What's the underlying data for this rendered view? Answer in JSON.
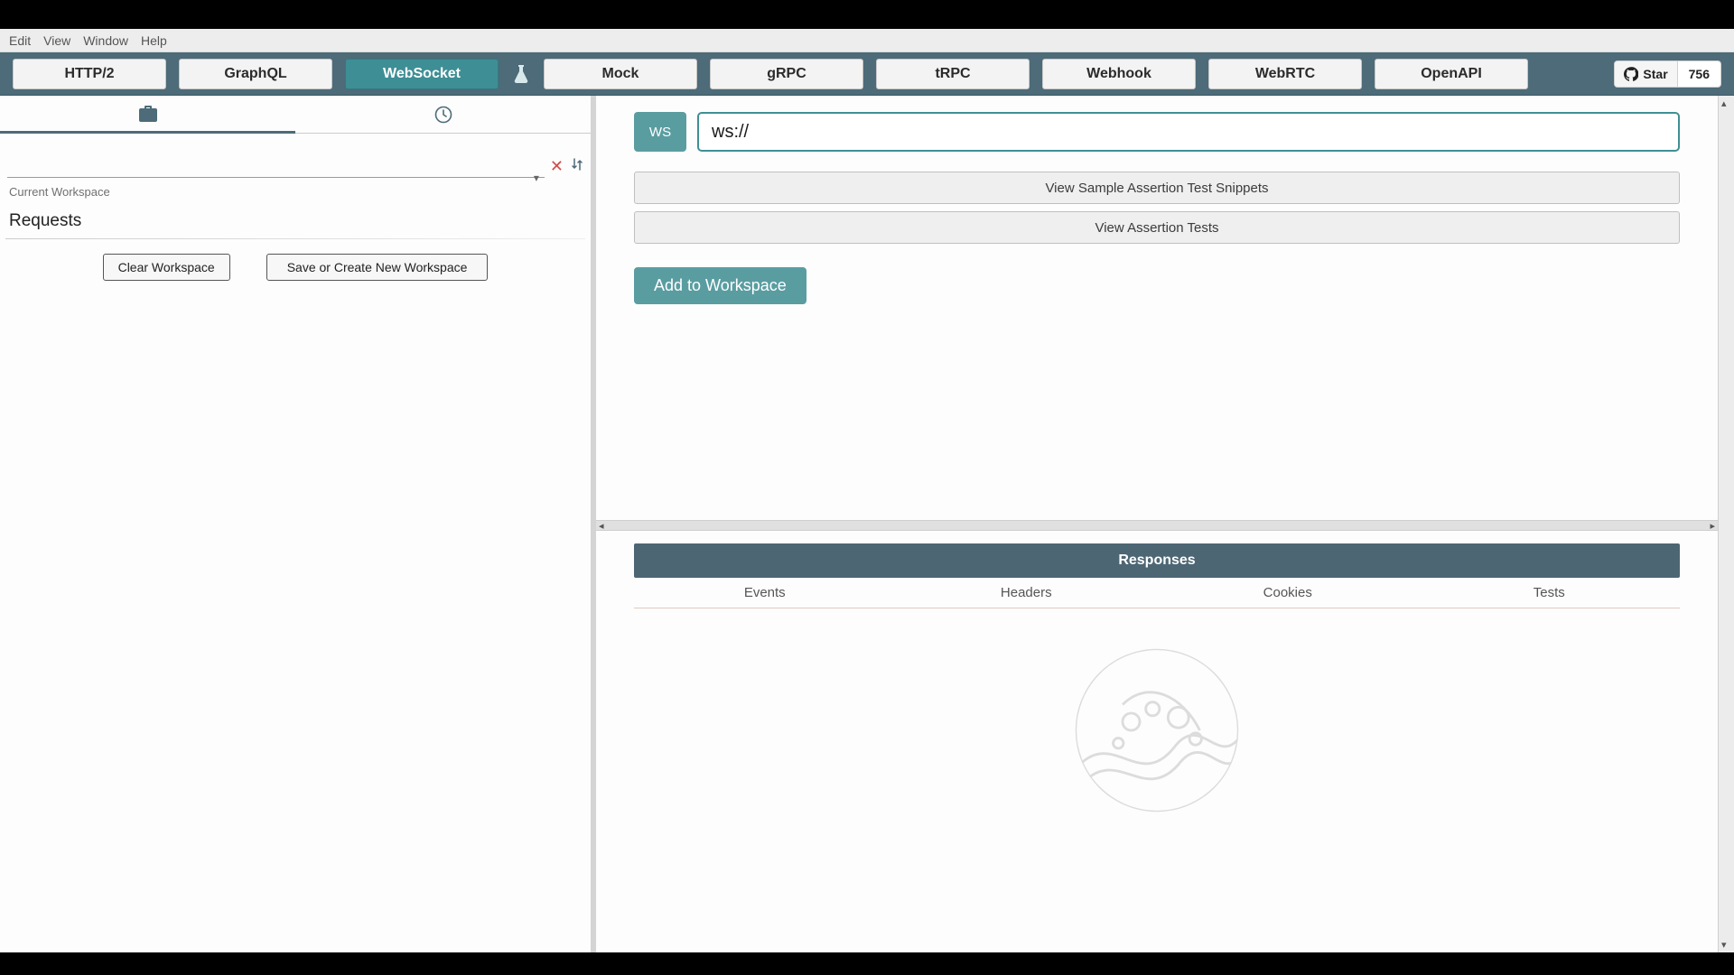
{
  "menubar": [
    "Edit",
    "View",
    "Window",
    "Help"
  ],
  "toolbar": {
    "left_tabs": [
      {
        "id": "http2",
        "label": "HTTP/2",
        "active": false
      },
      {
        "id": "graphql",
        "label": "GraphQL",
        "active": false
      },
      {
        "id": "websocket",
        "label": "WebSocket",
        "active": true
      }
    ],
    "right_tabs": [
      {
        "id": "mock",
        "label": "Mock"
      },
      {
        "id": "grpc",
        "label": "gRPC"
      },
      {
        "id": "trpc",
        "label": "tRPC"
      },
      {
        "id": "webhook",
        "label": "Webhook"
      },
      {
        "id": "webrtc",
        "label": "WebRTC"
      },
      {
        "id": "openapi",
        "label": "OpenAPI"
      }
    ],
    "github": {
      "star_label": "Star",
      "count": "756"
    }
  },
  "sidebar": {
    "workspace_select_value": "",
    "workspace_label": "Current Workspace",
    "requests_heading": "Requests",
    "clear_btn": "Clear Workspace",
    "save_btn": "Save or Create New Workspace"
  },
  "request": {
    "method": "WS",
    "url_value": "ws://",
    "view_snippets_btn": "View Sample Assertion Test Snippets",
    "view_tests_btn": "View Assertion Tests",
    "add_ws_btn": "Add to Workspace"
  },
  "responses": {
    "header": "Responses",
    "tabs": [
      "Events",
      "Headers",
      "Cookies",
      "Tests"
    ]
  }
}
